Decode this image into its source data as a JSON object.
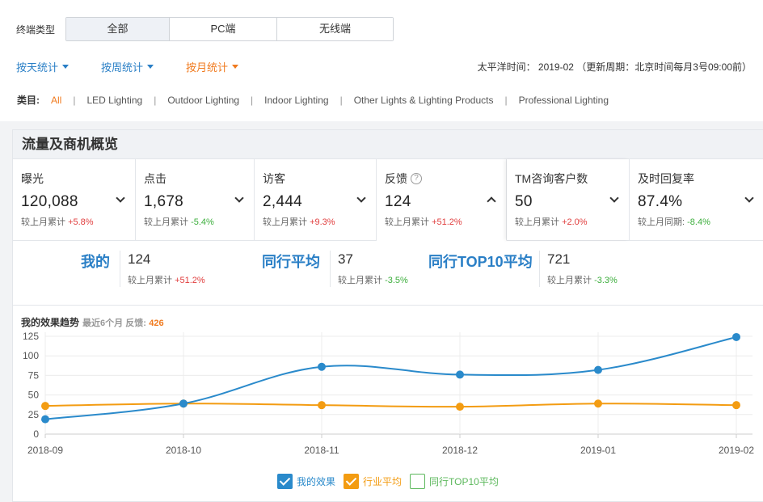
{
  "terminal": {
    "label": "终端类型",
    "options": [
      "全部",
      "PC端",
      "无线端"
    ],
    "selected": "全部"
  },
  "stats": {
    "day": "按天统计",
    "week": "按周统计",
    "month": "按月统计",
    "selected": "按月统计",
    "time_info": "太平洋时间： 2019-02 （更新周期：北京时间每月3号09:00前）"
  },
  "category": {
    "label": "类目:",
    "items": [
      "All",
      "LED Lighting",
      "Outdoor Lighting",
      "Indoor Lighting",
      "Other Lights & Lighting Products",
      "Professional Lighting"
    ],
    "selected": "All",
    "separator": "|"
  },
  "panel": {
    "title": "流量及商机概览",
    "metrics": [
      {
        "name": "曝光",
        "value": "120,088",
        "cmp_label": "较上月累计",
        "cmp_value": "+5.8%",
        "trend": "up"
      },
      {
        "name": "点击",
        "value": "1,678",
        "cmp_label": "较上月累计",
        "cmp_value": "-5.4%",
        "trend": "down"
      },
      {
        "name": "访客",
        "value": "2,444",
        "cmp_label": "较上月累计",
        "cmp_value": "+9.3%",
        "trend": "up"
      },
      {
        "name": "反馈",
        "value": "124",
        "cmp_label": "较上月累计",
        "cmp_value": "+51.2%",
        "trend": "up",
        "help": "?"
      },
      {
        "name": "TM咨询客户数",
        "value": "50",
        "cmp_label": "较上月累计",
        "cmp_value": "+2.0%",
        "trend": "up"
      },
      {
        "name": "及时回复率",
        "value": "87.4%",
        "cmp_label": "较上月同期:",
        "cmp_value": "-8.4%",
        "trend": "down"
      }
    ],
    "compare": {
      "mine": {
        "title": "我的",
        "value": "124",
        "cmp_label": "较上月累计",
        "cmp_value": "+51.2%"
      },
      "avg": {
        "title": "同行平均",
        "value": "37",
        "cmp_label": "较上月累计",
        "cmp_value": "-3.5%"
      },
      "top10": {
        "title": "同行TOP10平均",
        "value": "721",
        "cmp_label": "较上月累计",
        "cmp_value": "-3.3%"
      }
    },
    "trend": {
      "title": "我的效果趋势",
      "subtitle": "最近6个月 反馈:",
      "count": "426"
    }
  },
  "colors": {
    "blue": "#2a8acb",
    "orange": "#f39c12",
    "green": "#5cb85c",
    "red": "#e03c3c"
  },
  "chart_data": {
    "type": "line",
    "x": [
      "2018-09",
      "2018-10",
      "2018-11",
      "2018-12",
      "2019-01",
      "2019-02"
    ],
    "yticks": [
      0,
      25,
      50,
      75,
      100,
      125
    ],
    "ylim": [
      0,
      125
    ],
    "grid": true,
    "legend_position": "bottom",
    "series": [
      {
        "name": "我的效果",
        "color": "#2a8acb",
        "values": [
          19,
          39,
          86,
          76,
          82,
          124
        ],
        "checked": true
      },
      {
        "name": "行业平均",
        "color": "#f39c12",
        "values": [
          36,
          39,
          37,
          35,
          39,
          37
        ],
        "checked": true
      },
      {
        "name": "同行TOP10平均",
        "color": "#5cb85c",
        "values": [],
        "checked": false
      }
    ]
  }
}
